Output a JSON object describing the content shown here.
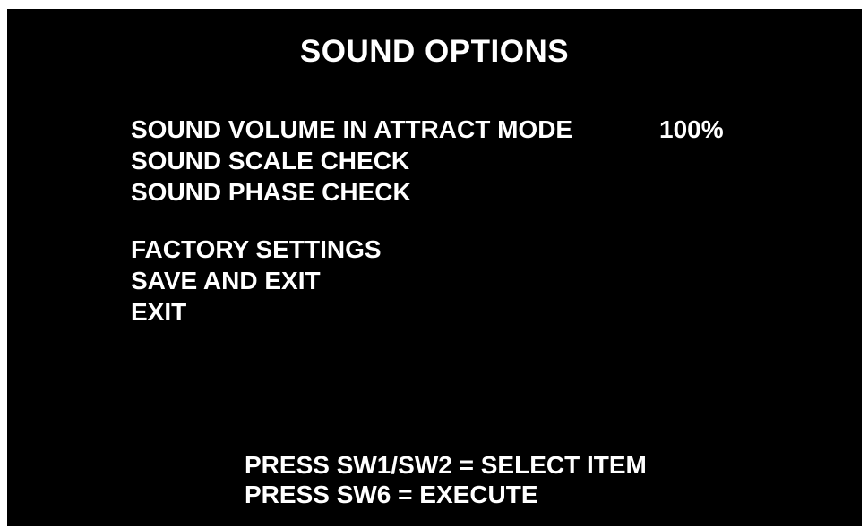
{
  "title": "SOUND OPTIONS",
  "menu": {
    "items": [
      {
        "label": "SOUND VOLUME IN ATTRACT MODE",
        "value": "100%"
      },
      {
        "label": "SOUND SCALE CHECK"
      },
      {
        "label": "SOUND PHASE CHECK"
      }
    ],
    "actions": [
      {
        "label": "FACTORY SETTINGS"
      },
      {
        "label": "SAVE AND EXIT"
      },
      {
        "label": "EXIT"
      }
    ]
  },
  "instructions": [
    "PRESS SW1/SW2 = SELECT ITEM",
    "PRESS SW6 = EXECUTE"
  ],
  "colors": {
    "background": "#000000",
    "text": "#ffffff"
  }
}
